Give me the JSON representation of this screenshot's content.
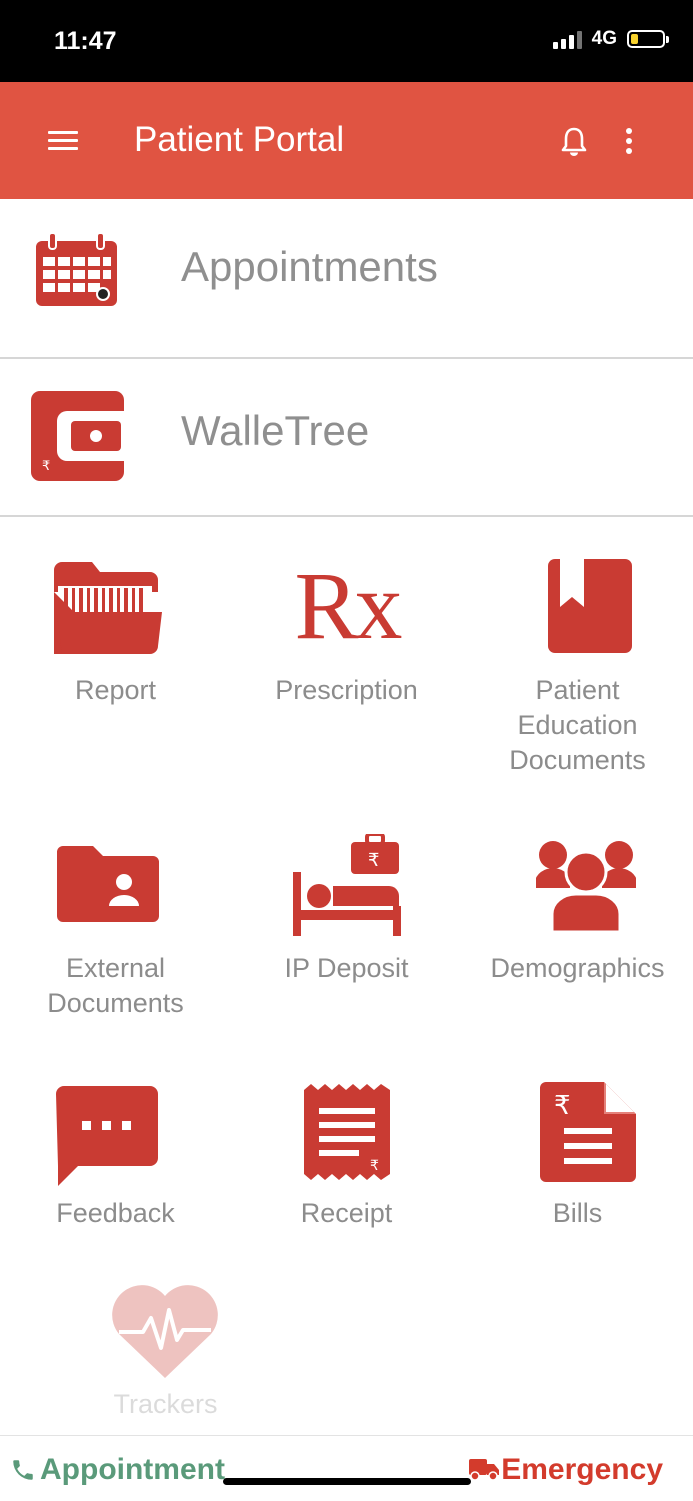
{
  "status_bar": {
    "time": "11:47",
    "network": "4G"
  },
  "app_bar": {
    "title": "Patient Portal"
  },
  "rows": {
    "appointments": "Appointments",
    "walletree": "WalleTree"
  },
  "tiles": {
    "report": "Report",
    "prescription": "Prescription",
    "prescription_icon_text": "Rx",
    "patient_education": [
      "Patient",
      "Education",
      "Documents"
    ],
    "external_documents": [
      "External",
      "Documents"
    ],
    "ip_deposit": "IP Deposit",
    "demographics": "Demographics",
    "feedback": "Feedback",
    "receipt": "Receipt",
    "bills": "Bills",
    "trackers": "Trackers"
  },
  "bottom_bar": {
    "appointment_label": "Appointment",
    "emergency_label": "Emergency"
  },
  "colors": {
    "brand_red": "#e05442",
    "icon_red": "#c93b33",
    "label_gray": "#8c8c8c",
    "appointment_green": "#5a9a7a",
    "emergency_red": "#d33b2c"
  },
  "icons": {
    "menu": "hamburger-icon",
    "notifications": "bell-icon",
    "more": "kebab-icon",
    "appointments": "calendar-icon",
    "walletree": "wallet-icon",
    "report": "folder-report-icon",
    "prescription": "rx-icon",
    "patient_education": "bookmark-book-icon",
    "external_documents": "folder-user-icon",
    "ip_deposit": "bed-deposit-icon",
    "demographics": "people-icon",
    "feedback": "chat-bubble-icon",
    "receipt": "receipt-icon",
    "bills": "bill-document-icon",
    "trackers": "heartbeat-icon",
    "appointment_call": "phone-icon",
    "emergency": "ambulance-icon"
  }
}
